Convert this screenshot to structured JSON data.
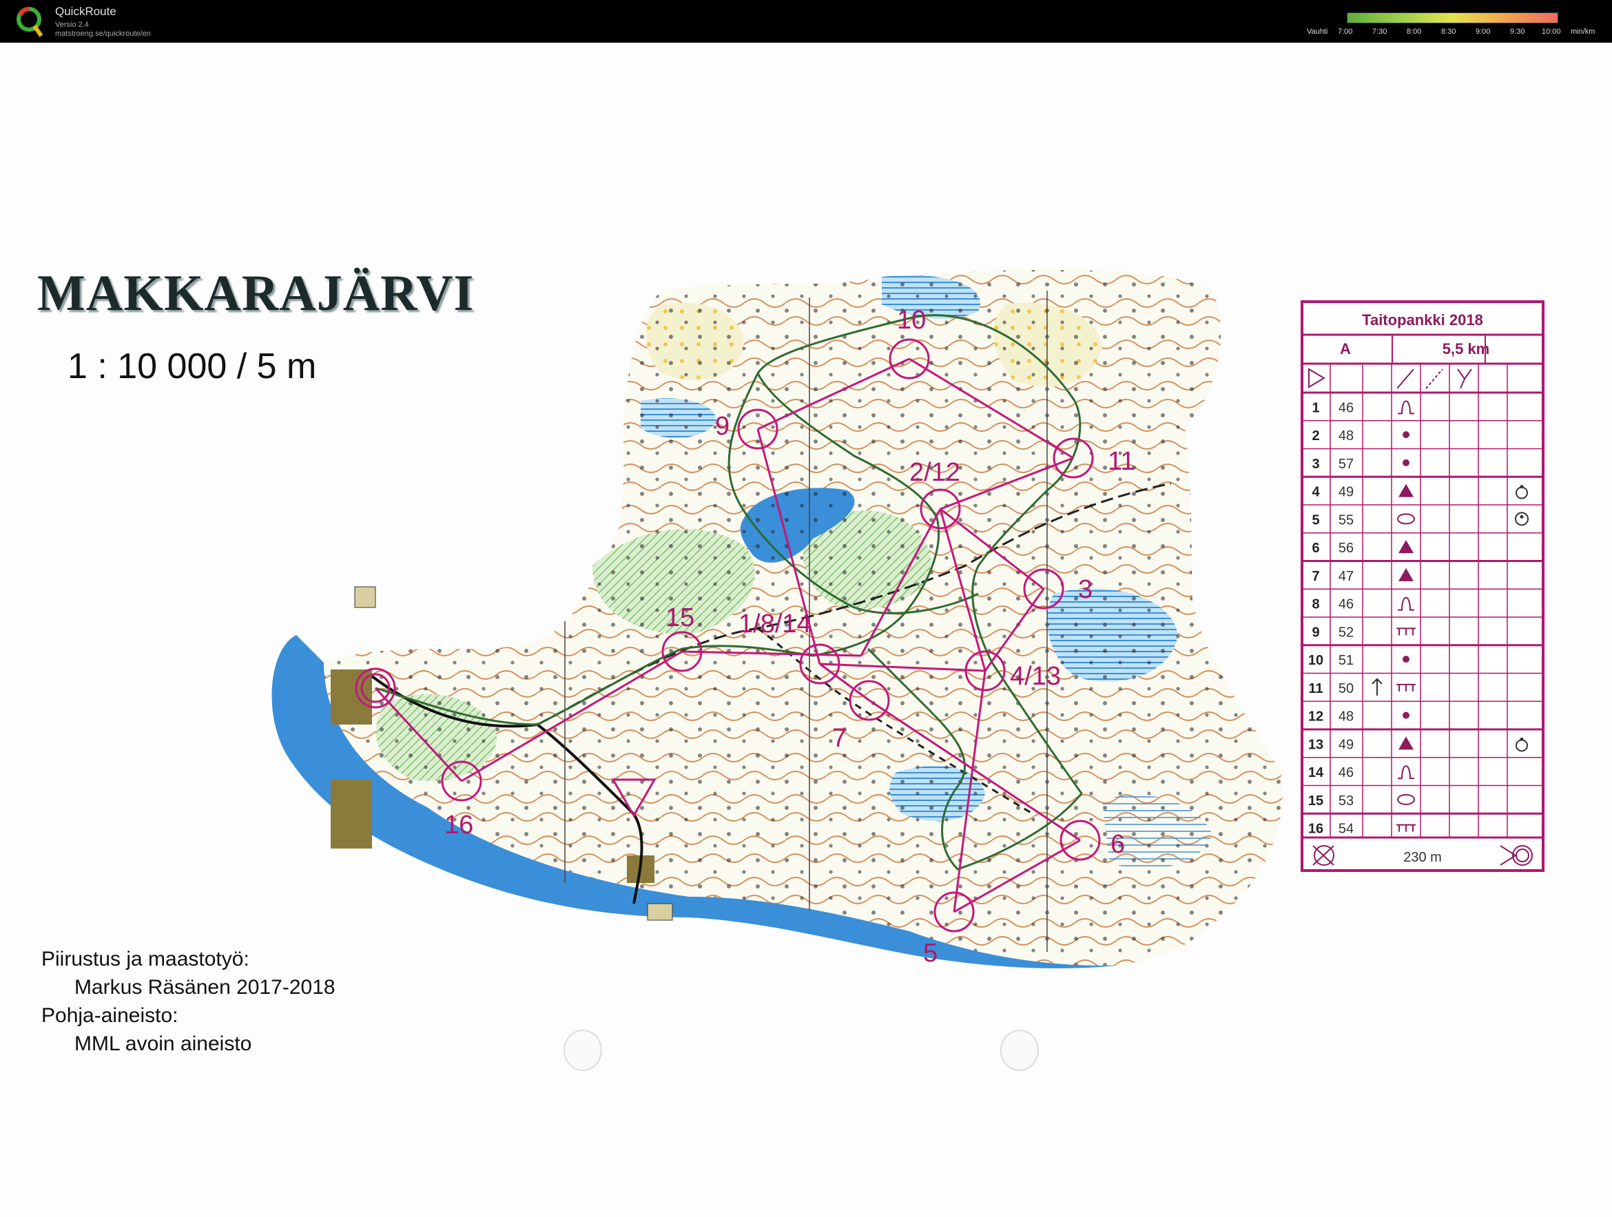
{
  "app": {
    "name": "QuickRoute",
    "version": "Versio 2.4",
    "url": "matstroeng.se/quickroute/en"
  },
  "pace_legend": {
    "label": "Vauhti",
    "ticks": [
      "7:00",
      "7:30",
      "8:00",
      "8:30",
      "9:00",
      "9:30",
      "10:00"
    ],
    "unit": "min/km",
    "colors": [
      "#5fae3c",
      "#9ed04c",
      "#e4e24e",
      "#f1a64c",
      "#ec6c62"
    ]
  },
  "map": {
    "title": "MAKKARAJÄRVI",
    "scale": "1 : 10 000 / 5 m",
    "credits": {
      "drawing_label": "Piirustus ja maastotyö:",
      "drawing_value": "Markus Räsänen 2017-2018",
      "base_label": "Pohja-aineisto:",
      "base_value": "MML avoin aineisto"
    },
    "control_labels": [
      "10",
      "9",
      "11",
      "2/12",
      "3",
      "15",
      "1/8/14",
      "4/13",
      "7",
      "16",
      "6",
      "5"
    ],
    "colors": {
      "course": "#c2187a",
      "route": "#2f6b32",
      "water": "#3a8fd8",
      "contour": "#c9763a",
      "open_land": "#f4f1cf"
    }
  },
  "control_description": {
    "title": "Taitopankki 2018",
    "class": "A",
    "length": "5,5 km",
    "rows": [
      {
        "n": "1",
        "code": "46",
        "sym": "knoll",
        "extra": ""
      },
      {
        "n": "2",
        "code": "48",
        "sym": "dot",
        "extra": ""
      },
      {
        "n": "3",
        "code": "57",
        "sym": "dot",
        "extra": ""
      },
      {
        "n": "4",
        "code": "49",
        "sym": "triangle",
        "extra": "top"
      },
      {
        "n": "5",
        "code": "55",
        "sym": "ellipse",
        "extra": "side"
      },
      {
        "n": "6",
        "code": "56",
        "sym": "triangle",
        "extra": ""
      },
      {
        "n": "7",
        "code": "47",
        "sym": "triangle",
        "extra": ""
      },
      {
        "n": "8",
        "code": "46",
        "sym": "knoll",
        "extra": ""
      },
      {
        "n": "9",
        "code": "52",
        "sym": "cliff",
        "extra": ""
      },
      {
        "n": "10",
        "code": "51",
        "sym": "dot",
        "extra": ""
      },
      {
        "n": "11",
        "code": "50",
        "sym": "cliff",
        "extra": "",
        "dir": "up"
      },
      {
        "n": "12",
        "code": "48",
        "sym": "dot",
        "extra": ""
      },
      {
        "n": "13",
        "code": "49",
        "sym": "triangle",
        "extra": "top"
      },
      {
        "n": "14",
        "code": "46",
        "sym": "knoll",
        "extra": ""
      },
      {
        "n": "15",
        "code": "53",
        "sym": "ellipse",
        "extra": ""
      },
      {
        "n": "16",
        "code": "54",
        "sym": "cliff",
        "extra": ""
      }
    ],
    "finish": "230 m"
  }
}
